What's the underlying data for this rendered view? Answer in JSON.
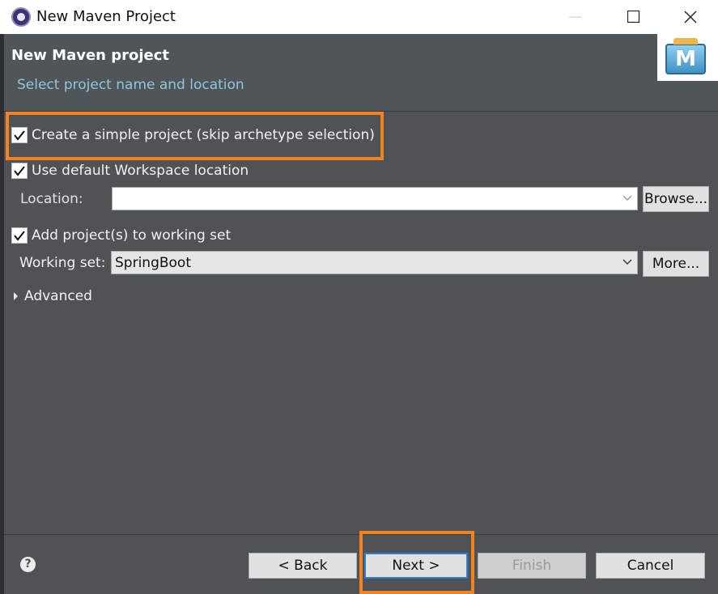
{
  "window": {
    "title": "New Maven Project",
    "icon": "eclipse-icon"
  },
  "header": {
    "title": "New Maven project",
    "subtitle": "Select project name and location",
    "banner_icon": "maven-icon",
    "banner_letter": "M"
  },
  "options": {
    "simple_project": {
      "label": "Create a simple project (skip archetype selection)",
      "checked": true
    },
    "default_workspace": {
      "label": "Use default Workspace location",
      "checked": true
    },
    "location": {
      "label": "Location:",
      "value": "",
      "browse_label": "Browse..."
    },
    "working_set_checkbox": {
      "label": "Add project(s) to working set",
      "checked": true
    },
    "working_set": {
      "label": "Working set:",
      "value": "SpringBoot",
      "more_label": "More..."
    },
    "advanced": {
      "label": "Advanced"
    }
  },
  "footer": {
    "help_glyph": "?",
    "back_label": "< Back",
    "next_label": "Next >",
    "finish_label": "Finish",
    "cancel_label": "Cancel"
  },
  "colors": {
    "background": "#4f5356",
    "highlight": "#f58220",
    "subtitle": "#93c5d8",
    "default_button_border": "#2e7fcf"
  }
}
